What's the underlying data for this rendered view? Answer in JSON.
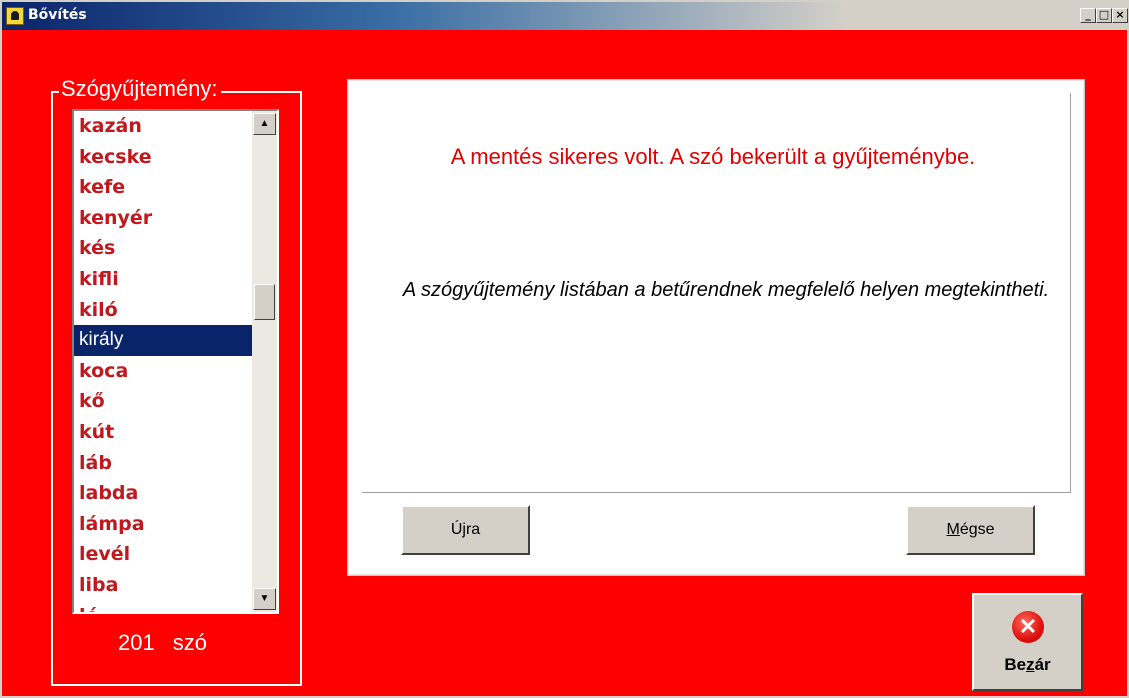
{
  "window": {
    "title": "Bővítés",
    "controls": {
      "minimize": "_",
      "maximize": "□",
      "close": "×"
    }
  },
  "wordlist": {
    "legend": "Szógyűjtemény:",
    "items": [
      "kazán",
      "kecske",
      "kefe",
      "kenyér",
      "kés",
      "kifli",
      "kiló",
      "király",
      "koca",
      "kő",
      "kút",
      "láb",
      "labda",
      "lámpa",
      "levél",
      "liba",
      "ló"
    ],
    "selected": "király",
    "count": "201",
    "count_unit": "szó"
  },
  "message": {
    "title": "A mentés sikeres volt. A szó bekerült a gyűjteménybe.",
    "body": "A szógyűjtemény listában a betűrendnek megfelelő helyen megtekintheti."
  },
  "buttons": {
    "retry": "Újra",
    "cancel": "Mégse",
    "close": "Bezár"
  },
  "colors": {
    "background": "#ff0000",
    "list_text": "#c0181c",
    "selection": "#0a246a",
    "message_title": "#e00000"
  },
  "icons": {
    "app": "app-icon",
    "close": "close-circle-icon"
  }
}
